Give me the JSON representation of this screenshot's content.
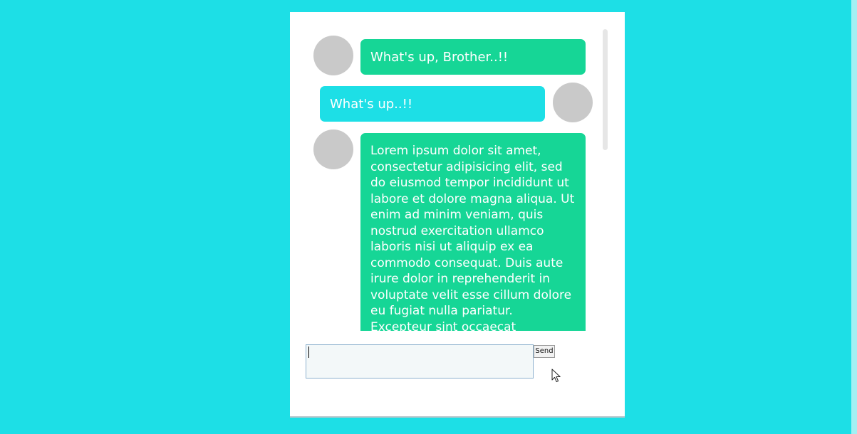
{
  "messages": [
    {
      "side": "left",
      "author": "friend",
      "text": "What's up, Brother..!!"
    },
    {
      "side": "right",
      "author": "me",
      "text": "What's up..!!"
    },
    {
      "side": "left",
      "author": "friend",
      "text": "Lorem ipsum dolor sit amet, consectetur adipisicing elit, sed do eiusmod tempor incididunt ut labore et dolore magna aliqua. Ut enim ad minim veniam, quis nostrud exercitation ullamco laboris nisi ut aliquip ex ea commodo consequat. Duis aute irure dolor in reprehenderit in voluptate velit esse cillum dolore eu fugiat nulla pariatur. Excepteur sint occaecat cupidatat non"
    }
  ],
  "composer": {
    "value": "",
    "send_label": "Send"
  },
  "colors": {
    "background": "#1ddfe6",
    "incoming_bubble": "#16d696",
    "outgoing_bubble": "#1ddfe6",
    "avatar": "#c9c9c9"
  }
}
